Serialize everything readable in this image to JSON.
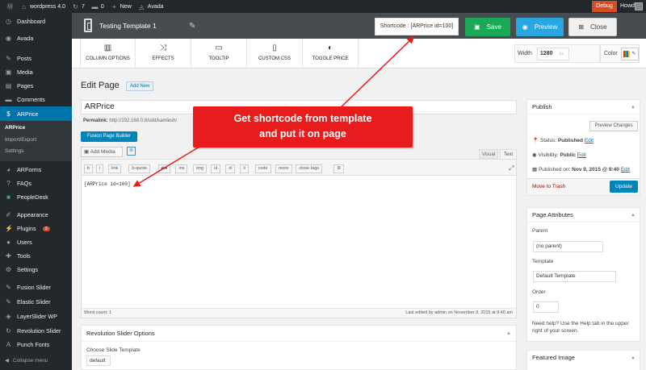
{
  "adminbar": {
    "site": "wordpress 4.0",
    "updates": "7",
    "comments": "0",
    "new": "New",
    "theme": "Avada",
    "debug": "Debug",
    "howdy": "Howdy, admin"
  },
  "sidebar": {
    "items": [
      {
        "label": "Dashboard",
        "icon": "gauge-icon"
      },
      {
        "label": "Avada",
        "icon": "avada-icon"
      },
      {
        "label": "Posts",
        "icon": "pin-icon"
      },
      {
        "label": "Media",
        "icon": "media-icon"
      },
      {
        "label": "Pages",
        "icon": "page-icon"
      },
      {
        "label": "Comments",
        "icon": "comment-icon"
      },
      {
        "label": "ARPrice",
        "icon": "arprice-icon"
      }
    ],
    "submenu": [
      "ARPrice",
      "Import/Export",
      "Settings"
    ],
    "items2": [
      {
        "label": "ARForms"
      },
      {
        "label": "FAQs"
      },
      {
        "label": "PeopleDesk"
      },
      {
        "label": "Appearance"
      },
      {
        "label": "Plugins",
        "badge": "3"
      },
      {
        "label": "Users"
      },
      {
        "label": "Tools"
      },
      {
        "label": "Settings"
      },
      {
        "label": "Fusion Slider"
      },
      {
        "label": "Elastic Slider"
      },
      {
        "label": "LayerSlider WP"
      },
      {
        "label": "Revolution Slider"
      },
      {
        "label": "Punch Fonts"
      }
    ],
    "collapse": "Collapse menu"
  },
  "header": {
    "title": "Testing Template 1",
    "shortcode": "Shortcode : [ARPrice id=100]",
    "save": "Save",
    "preview": "Preview",
    "close": "Close"
  },
  "toolbar": {
    "items": [
      "COLUMN OPTIONS",
      "EFFECTS",
      "TOOLTIP",
      "CUSTOM CSS",
      "TOGGLE PRICE"
    ],
    "width_label": "Width",
    "width_value": "1280",
    "width_unit": "px",
    "color_label": "Color"
  },
  "edit": {
    "heading": "Edit Page",
    "add_new": "Add New",
    "title_value": "ARPrice",
    "permalink_label": "Permalink:",
    "permalink_url": "http://192.168.0.8/udit/kamlesh/",
    "fusion_builder": "Fusion Page Builder",
    "add_media": "Add Media",
    "tab_visual": "Visual",
    "tab_text": "Text",
    "quicktags": [
      "b",
      "i",
      "link",
      "b-quote",
      "del",
      "ins",
      "img",
      "ul",
      "ol",
      "li",
      "code",
      "more",
      "close tags"
    ],
    "content": "[ARPrice id=100]",
    "word_count": "Word count: 1",
    "last_edited": "Last edited by admin on November 9, 2015 at 9:40 am"
  },
  "revslider": {
    "title": "Revolution Slider Options",
    "label": "Choose Slide Template",
    "value": "default"
  },
  "publish": {
    "title": "Publish",
    "preview_changes": "Preview Changes",
    "status_label": "Status:",
    "status_value": "Published",
    "visibility_label": "Visibility:",
    "visibility_value": "Public",
    "published_label": "Published on:",
    "published_value": "Nov 9, 2015 @ 9:40",
    "edit": "Edit",
    "trash": "Move to Trash",
    "update": "Update"
  },
  "page_attributes": {
    "title": "Page Attributes",
    "parent_label": "Parent",
    "parent_value": "(no parent)",
    "template_label": "Template",
    "template_value": "Default Template",
    "order_label": "Order",
    "order_value": "0",
    "help": "Need help? Use the Help tab in the upper right of your screen."
  },
  "featured": {
    "title": "Featured Image"
  },
  "callout": {
    "line1": "Get shortcode from template",
    "line2": "and put it on page"
  },
  "colors": {
    "accent": "#0073aa",
    "save": "#1aaa55",
    "preview": "#28a7e0",
    "callout": "#e81c1c"
  }
}
